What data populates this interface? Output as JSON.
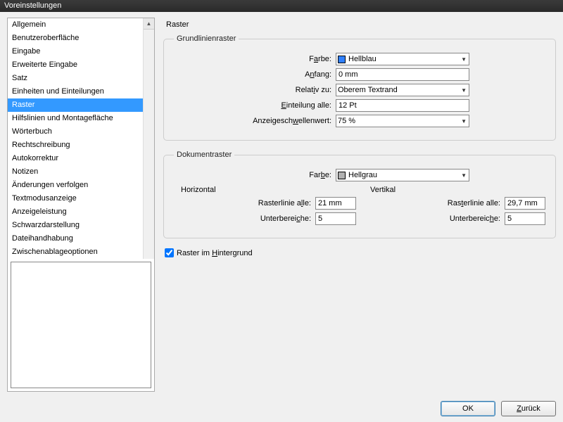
{
  "window": {
    "title": "Voreinstellungen"
  },
  "sidebar": {
    "items": [
      "Allgemein",
      "Benutzeroberfläche",
      "Eingabe",
      "Erweiterte Eingabe",
      "Satz",
      "Einheiten und Einteilungen",
      "Raster",
      "Hilfslinien und Montagefläche",
      "Wörterbuch",
      "Rechtschreibung",
      "Autokorrektur",
      "Notizen",
      "Änderungen verfolgen",
      "Textmodusanzeige",
      "Anzeigeleistung",
      "Schwarzdarstellung",
      "Dateihandhabung",
      "Zwischenablageoptionen"
    ],
    "selected_index": 6
  },
  "main": {
    "title": "Raster",
    "baseline": {
      "legend": "Grundlinienraster",
      "color_label_pre": "F",
      "color_label_u": "a",
      "color_label_post": "rbe:",
      "color_value": "Hellblau",
      "start_label_pre": "A",
      "start_label_u": "n",
      "start_label_post": "fang:",
      "start_value": "0 mm",
      "relative_label_pre": "Relat",
      "relative_label_u": "i",
      "relative_label_post": "v zu:",
      "relative_value": "Oberem Textrand",
      "increment_label_pre": "",
      "increment_label_u": "E",
      "increment_label_post": "inteilung alle:",
      "increment_value": "12 Pt",
      "threshold_label_pre": "Anzeigesch",
      "threshold_label_u": "w",
      "threshold_label_post": "ellenwert:",
      "threshold_value": "75 %"
    },
    "document": {
      "legend": "Dokumentraster",
      "color_label_pre": "Far",
      "color_label_u": "b",
      "color_label_post": "e:",
      "color_value": "Hellgrau",
      "horizontal_title": "Horizontal",
      "vertical_title": "Vertikal",
      "h_gridline_label_pre": "Rasterlinie a",
      "h_gridline_label_u": "l",
      "h_gridline_label_post": "le:",
      "h_gridline_value": "21 mm",
      "h_sub_label_pre": "Unterberei",
      "h_sub_label_u": "c",
      "h_sub_label_post": "he:",
      "h_sub_value": "5",
      "v_gridline_label_pre": "Ras",
      "v_gridline_label_u": "t",
      "v_gridline_label_post": "erlinie alle:",
      "v_gridline_value": "29,7 mm",
      "v_sub_label_pre": "Unterbereic",
      "v_sub_label_u": "h",
      "v_sub_label_post": "e:",
      "v_sub_value": "5"
    },
    "checkbox": {
      "checked": true,
      "label_pre": "Raster im ",
      "label_u": "H",
      "label_post": "intergrund"
    }
  },
  "footer": {
    "ok": "OK",
    "back_pre": "",
    "back_u": "Z",
    "back_post": "urück"
  }
}
